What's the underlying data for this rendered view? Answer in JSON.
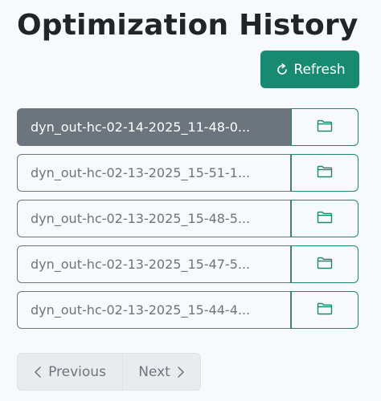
{
  "page": {
    "title": "Optimization History"
  },
  "toolbar": {
    "refresh_label": "Refresh",
    "refresh_icon": "refresh-icon"
  },
  "history": {
    "items": [
      {
        "label": "dyn_out-hc-02-14-2025_11-48-0...",
        "active": true
      },
      {
        "label": "dyn_out-hc-02-13-2025_15-51-1...",
        "active": false
      },
      {
        "label": "dyn_out-hc-02-13-2025_15-48-5...",
        "active": false
      },
      {
        "label": "dyn_out-hc-02-13-2025_15-47-5...",
        "active": false
      },
      {
        "label": "dyn_out-hc-02-13-2025_15-44-4...",
        "active": false
      }
    ],
    "action_icon": "folder-icon"
  },
  "pagination": {
    "previous_label": "Previous",
    "next_label": "Next",
    "previous_icon": "chevron-left-icon",
    "next_icon": "chevron-right-icon"
  },
  "colors": {
    "accent": "#198a72",
    "active_item": "#6c757d",
    "background": "#f8f9fa",
    "title": "#212529"
  }
}
